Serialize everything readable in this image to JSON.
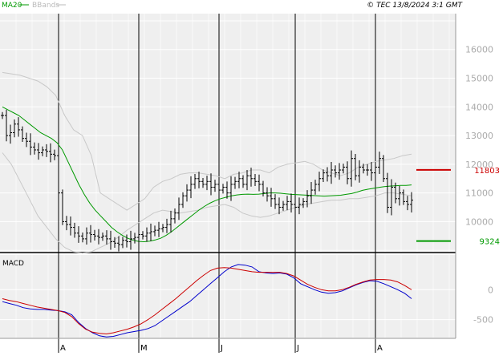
{
  "header": {
    "indicator_ma": "MA20",
    "indicator_bb": "BBands",
    "copyright": "© TEC 13/8/2024 3:1 GMT"
  },
  "colors": {
    "panel_bg": "#efefef",
    "grid": "#ffffff",
    "price_bar": "#000000",
    "ma20": "#009900",
    "bbands": "#c8c8c8",
    "macd_line": "#0000cc",
    "signal_line": "#cc0000",
    "resistance": "#cc0000",
    "support": "#009900",
    "axis_text": "#aaaaaa"
  },
  "chart_data": [
    {
      "type": "line",
      "name": "price",
      "x_tick_labels": [
        "A",
        "M",
        "J",
        "J",
        "A"
      ],
      "y_ticks": [
        10000,
        11000,
        12000,
        13000,
        14000,
        15000,
        16000
      ],
      "y_tick_labels": [
        "10000",
        "11000",
        "12000",
        "13000",
        "14000",
        "15000",
        "16000"
      ],
      "ylim": [
        8950,
        17250
      ],
      "n_bars": 103,
      "grid": true,
      "levels": [
        {
          "name": "resistance",
          "value": 11803,
          "label": "11803"
        },
        {
          "name": "support",
          "value": 9324,
          "label": "9324"
        }
      ],
      "close": [
        13700,
        13000,
        13100,
        13400,
        13200,
        12900,
        12800,
        12600,
        12500,
        12400,
        12500,
        12450,
        12350,
        12300,
        11000,
        10000,
        9900,
        9800,
        9600,
        9500,
        9400,
        9600,
        9550,
        9500,
        9450,
        9500,
        9400,
        9300,
        9250,
        9200,
        9350,
        9300,
        9400,
        9450,
        9550,
        9500,
        9600,
        9650,
        9700,
        9750,
        9800,
        9900,
        10100,
        10300,
        10600,
        10900,
        11100,
        11300,
        11500,
        11400,
        11300,
        11400,
        11200,
        11300,
        11100,
        11200,
        11000,
        11300,
        11400,
        11500,
        11300,
        11600,
        11500,
        11400,
        11300,
        11000,
        10900,
        10800,
        10600,
        10500,
        10600,
        10700,
        10600,
        10500,
        10600,
        10700,
        10900,
        11100,
        11300,
        11500,
        11700,
        11600,
        11800,
        11700,
        11800,
        11900,
        11500,
        12200,
        11600,
        11900,
        11800,
        11800,
        11700,
        11900,
        12200,
        11500,
        10500,
        11200,
        10800,
        11000,
        10700,
        10600,
        10750
      ],
      "ma20": [
        14000,
        13900,
        13800,
        13700,
        13550,
        13400,
        13250,
        13100,
        13000,
        12900,
        12750,
        12500,
        12100,
        11700,
        11300,
        10950,
        10650,
        10400,
        10200,
        10000,
        9800,
        9650,
        9520,
        9420,
        9350,
        9310,
        9300,
        9320,
        9360,
        9420,
        9520,
        9650,
        9800,
        9950,
        10100,
        10250,
        10400,
        10530,
        10640,
        10730,
        10800,
        10850,
        10900,
        10930,
        10950,
        10960,
        10950,
        10960,
        10980,
        11000,
        11000,
        10990,
        10970,
        10950,
        10940,
        10930,
        10920,
        10910,
        10900,
        10890,
        10900,
        10910,
        10920,
        10950,
        10980,
        11030,
        11090,
        11130,
        11160,
        11190,
        11220,
        11240,
        11250,
        11260,
        11260,
        11280
      ],
      "bb_upper": [
        15200,
        15150,
        15100,
        15000,
        14900,
        14700,
        14400,
        13700,
        13200,
        13000,
        12300,
        11000,
        10800,
        10600,
        10400,
        10600,
        10800,
        11200,
        11400,
        11500,
        11650,
        11700,
        11700,
        11650,
        11600,
        11500,
        11650,
        11700,
        11800,
        11800,
        11700,
        11900,
        12000,
        12050,
        12100,
        12000,
        11800,
        11700,
        11600,
        11700,
        11900,
        12000,
        12100,
        12150,
        12200,
        12300,
        12350
      ],
      "bb_lower": [
        12400,
        12000,
        11400,
        10800,
        10200,
        9800,
        9400,
        9100,
        8950,
        8900,
        8950,
        9100,
        9250,
        9450,
        9700,
        9900,
        10100,
        10300,
        10400,
        10350,
        10300,
        10350,
        10400,
        10500,
        10550,
        10600,
        10500,
        10300,
        10200,
        10150,
        10200,
        10300,
        10400,
        10500,
        10600,
        10650,
        10700,
        10750,
        10750,
        10800,
        10800,
        10850,
        10900,
        11000,
        11000,
        10950,
        10900
      ]
    },
    {
      "type": "line",
      "name": "MACD",
      "y_ticks": [
        0,
        -500
      ],
      "y_tick_labels": [
        "0",
        "-500"
      ],
      "ylim": [
        -800,
        580
      ],
      "grid": true,
      "series": [
        {
          "name": "macd",
          "values": [
            -200,
            -230,
            -260,
            -300,
            -320,
            -330,
            -330,
            -340,
            -350,
            -370,
            -420,
            -550,
            -650,
            -720,
            -770,
            -790,
            -780,
            -750,
            -720,
            -700,
            -680,
            -650,
            -600,
            -520,
            -440,
            -360,
            -280,
            -200,
            -100,
            0,
            100,
            200,
            300,
            380,
            420,
            410,
            380,
            300,
            280,
            270,
            280,
            260,
            200,
            100,
            50,
            0,
            -40,
            -60,
            -50,
            -20,
            30,
            80,
            120,
            150,
            140,
            100,
            50,
            0,
            -60,
            -150
          ]
        },
        {
          "name": "signal",
          "values": [
            -150,
            -180,
            -200,
            -230,
            -260,
            -290,
            -310,
            -330,
            -350,
            -380,
            -450,
            -570,
            -660,
            -710,
            -730,
            -740,
            -720,
            -690,
            -660,
            -620,
            -570,
            -500,
            -420,
            -330,
            -240,
            -150,
            -50,
            50,
            150,
            240,
            320,
            360,
            370,
            360,
            340,
            320,
            300,
            290,
            290,
            290,
            290,
            270,
            230,
            160,
            90,
            40,
            0,
            -20,
            -20,
            0,
            40,
            90,
            130,
            160,
            170,
            170,
            160,
            130,
            70,
            0
          ]
        }
      ]
    }
  ]
}
